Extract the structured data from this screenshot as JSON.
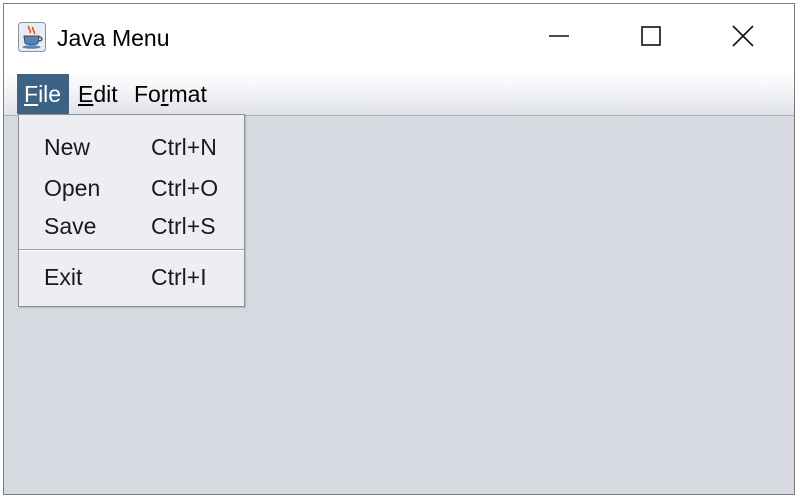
{
  "window": {
    "title": "Java Menu",
    "icon": "java-cup-icon"
  },
  "title_controls": {
    "minimize_icon": "minimize-icon",
    "maximize_icon": "maximize-icon",
    "close_icon": "close-icon"
  },
  "menubar": {
    "menus": [
      {
        "label": "File",
        "mnemonic": "F",
        "rest": "ile",
        "active": true
      },
      {
        "label": "Edit",
        "mnemonic": "E",
        "rest": "dit",
        "active": false
      },
      {
        "label": "Format",
        "pre": "Fo",
        "mnemonic": "r",
        "rest": "mat",
        "active": false
      }
    ]
  },
  "file_menu": {
    "items": [
      {
        "label": "New",
        "accelerator": "Ctrl+N"
      },
      {
        "label": "Open",
        "accelerator": "Ctrl+O"
      },
      {
        "label": "Save",
        "accelerator": "Ctrl+S"
      },
      {
        "label": "Exit",
        "accelerator": "Ctrl+I"
      }
    ]
  },
  "colors": {
    "menu_active_bg": "#3c6384",
    "client_area_bg": "#d6d9e0",
    "popup_bg": "#eceef2"
  }
}
